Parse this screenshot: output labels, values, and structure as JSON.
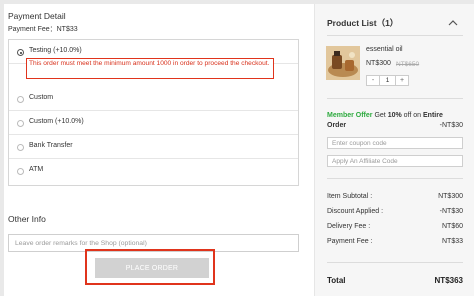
{
  "payment": {
    "title": "Payment Detail",
    "fee_line": "Payment Fee：NT$33",
    "methods": [
      {
        "label": "Testing (+10.0%)",
        "selected": true
      },
      {
        "label": "Custom",
        "selected": false
      },
      {
        "label": "Custom (+10.0%)",
        "selected": false
      },
      {
        "label": "Bank Transfer",
        "selected": false
      },
      {
        "label": "ATM",
        "selected": false
      }
    ],
    "warning": "This order must meet the minimum amount 1000 in order to proceed the checkout."
  },
  "other": {
    "title": "Other Info",
    "remarks_placeholder": "Leave order remarks for the Shop (optional)"
  },
  "place_order": "PLACE ORDER",
  "product_list": {
    "title": "Product List（1）",
    "item": {
      "name": "essential oil",
      "price": "NT$300",
      "old_price": "NT$650",
      "quantity": "1",
      "minus": "-",
      "plus": "+"
    }
  },
  "offer": {
    "label": "Member Offer",
    "text_a": " Get ",
    "pct": "10%",
    "text_b": " off on ",
    "scope": "Entire Order",
    "amount": "-NT$30"
  },
  "coupon_placeholder": "Enter coupon code",
  "affiliate_placeholder": "Apply An Affiliate Code",
  "summary": [
    {
      "label": "Item Subtotal :",
      "value": "NT$300"
    },
    {
      "label": "Discount Applied :",
      "value": "-NT$30"
    },
    {
      "label": "Delivery Fee :",
      "value": "NT$60"
    },
    {
      "label": "Payment Fee :",
      "value": "NT$33"
    }
  ],
  "total": {
    "label": "Total",
    "value": "NT$363"
  },
  "colors": {
    "accent_red": "#e0341c",
    "offer_green": "#2eaa3f",
    "button_disabled": "#d2d2d2"
  }
}
